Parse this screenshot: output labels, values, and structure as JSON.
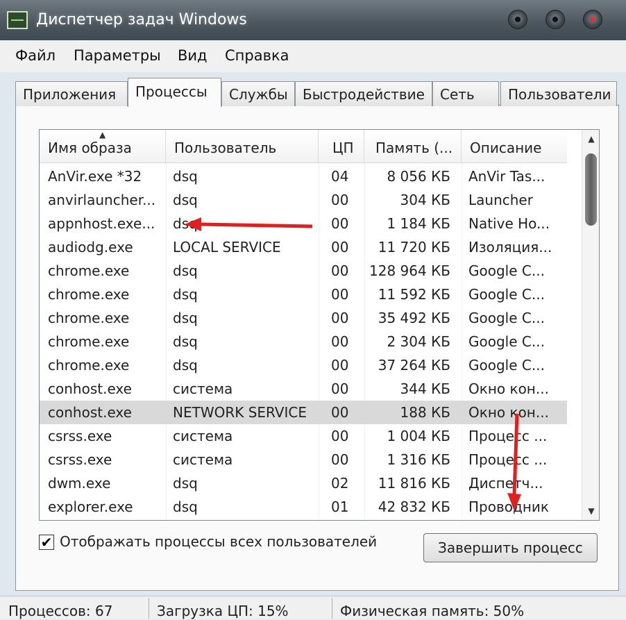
{
  "window": {
    "title": "Диспетчер задач Windows"
  },
  "menu": [
    "Файл",
    "Параметры",
    "Вид",
    "Справка"
  ],
  "tabs": [
    "Приложения",
    "Процессы",
    "Службы",
    "Быстродействие",
    "Сеть",
    "Пользователи"
  ],
  "active_tab": "Процессы",
  "table": {
    "columns": [
      "Имя образа",
      "Пользователь",
      "ЦП",
      "Память (...",
      "Описание"
    ],
    "sorted_by": "Имя образа",
    "rows": [
      {
        "name": "AnVir.exe *32",
        "user": "dsq",
        "cpu": "04",
        "mem": "8 056 КБ",
        "desc": "AnVir Tas..."
      },
      {
        "name": "anvirlauncher...",
        "user": "dsq",
        "cpu": "00",
        "mem": "304 КБ",
        "desc": "Launcher"
      },
      {
        "name": "appnhost.exe...",
        "user": "dsq",
        "cpu": "00",
        "mem": "1 184 КБ",
        "desc": "Native Ho..."
      },
      {
        "name": "audiodg.exe",
        "user": "LOCAL SERVICE",
        "cpu": "00",
        "mem": "11 720 КБ",
        "desc": "Изоляция..."
      },
      {
        "name": "chrome.exe",
        "user": "dsq",
        "cpu": "00",
        "mem": "128 964 КБ",
        "desc": "Google C..."
      },
      {
        "name": "chrome.exe",
        "user": "dsq",
        "cpu": "00",
        "mem": "11 592 КБ",
        "desc": "Google C..."
      },
      {
        "name": "chrome.exe",
        "user": "dsq",
        "cpu": "00",
        "mem": "35 492 КБ",
        "desc": "Google C..."
      },
      {
        "name": "chrome.exe",
        "user": "dsq",
        "cpu": "00",
        "mem": "2 304 КБ",
        "desc": "Google C..."
      },
      {
        "name": "chrome.exe",
        "user": "dsq",
        "cpu": "00",
        "mem": "37 264 КБ",
        "desc": "Google C..."
      },
      {
        "name": "conhost.exe",
        "user": "система",
        "cpu": "00",
        "mem": "344 КБ",
        "desc": "Окно кон..."
      },
      {
        "name": "conhost.exe",
        "user": "NETWORK SERVICE",
        "cpu": "00",
        "mem": "188 КБ",
        "desc": "Окно кон..."
      },
      {
        "name": "csrss.exe",
        "user": "система",
        "cpu": "00",
        "mem": "1 004 КБ",
        "desc": "Процесс ..."
      },
      {
        "name": "csrss.exe",
        "user": "система",
        "cpu": "00",
        "mem": "1 316 КБ",
        "desc": "Процесс ..."
      },
      {
        "name": "dwm.exe",
        "user": "dsq",
        "cpu": "02",
        "mem": "11 816 КБ",
        "desc": "Диспетч..."
      },
      {
        "name": "explorer.exe",
        "user": "dsq",
        "cpu": "01",
        "mem": "42 832 КБ",
        "desc": "Проводник"
      }
    ],
    "selected_row": 10
  },
  "show_all_users": {
    "label": "Отображать процессы всех пользователей",
    "checked": true,
    "check_glyph": "✔"
  },
  "end_process_button": "Завершить процесс",
  "status": {
    "processes": "Процессов: 67",
    "cpu_load": "Загрузка ЦП: 15%",
    "physical_memory": "Физическая память: 50%"
  },
  "annotations": {
    "arrow_color": "#e0201e"
  }
}
